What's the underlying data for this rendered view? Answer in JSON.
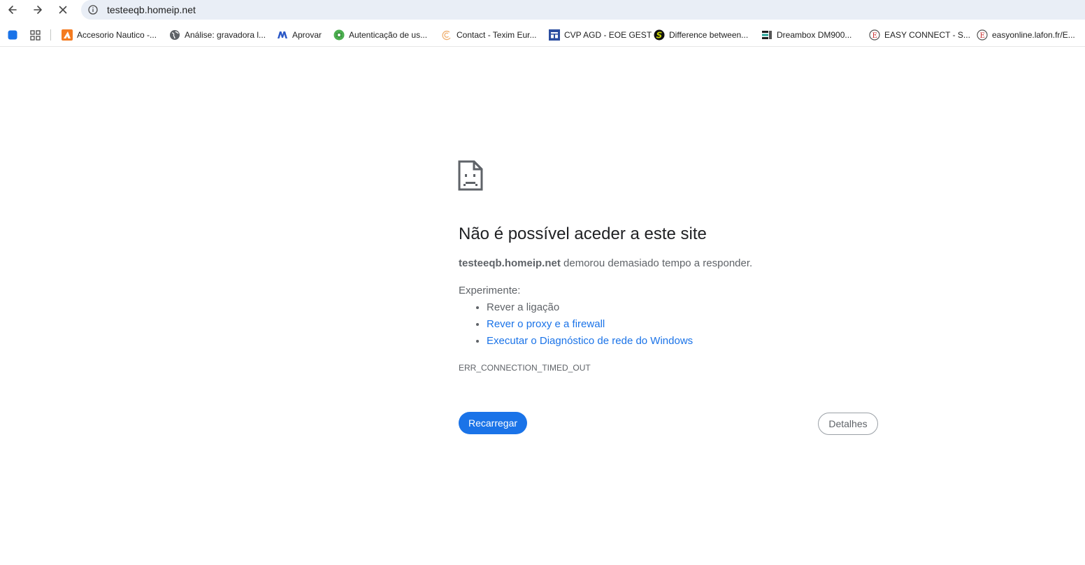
{
  "browser": {
    "url": "testeeqb.homeip.net",
    "nav": {
      "back_icon": "arrow-left-icon",
      "forward_icon": "arrow-right-icon",
      "stop_icon": "close-icon",
      "site_info_icon": "info-icon"
    }
  },
  "bookmarks": [
    {
      "label": "Accesorio Nautico -...",
      "icon": "orange-triangle-icon",
      "color": "#f47b20"
    },
    {
      "label": "Análise: gravadora l...",
      "icon": "globe-icon",
      "color": "#5f6368"
    },
    {
      "label": "Aprovar",
      "icon": "m-logo-icon",
      "color": "#2b58c6"
    },
    {
      "label": "Autenticação de us...",
      "icon": "green-gear-icon",
      "color": "#4caf50"
    },
    {
      "label": "Contact - Texim Eur...",
      "icon": "swirl-icon",
      "color": "#f0b070"
    },
    {
      "label": "CVP AGD - EOE GEST",
      "icon": "blue-window-icon",
      "color": "#2c4ea0"
    },
    {
      "label": "Difference between...",
      "icon": "s-logo-icon",
      "color": "#c8d400"
    },
    {
      "label": "Dreambox DM900...",
      "icon": "db-logo-icon",
      "color": "#1f1f1f"
    },
    {
      "label": "EASY CONNECT - S...",
      "icon": "e-circle-icon",
      "color": "#c62828"
    },
    {
      "label": "easyonline.lafon.fr/E...",
      "icon": "e-circle-icon",
      "color": "#c62828"
    }
  ],
  "error": {
    "title": "Não é possível aceder a este site",
    "host": "testeeqb.homeip.net",
    "message_rest": " demorou demasiado tempo a responder.",
    "try_label": "Experimente:",
    "suggestions": [
      "Rever a ligação",
      "Rever o proxy e a firewall",
      "Executar o Diagnóstico de rede do Windows"
    ],
    "code": "ERR_CONNECTION_TIMED_OUT",
    "reload_label": "Recarregar",
    "details_label": "Detalhes"
  },
  "colors": {
    "accent": "#1a73e8",
    "text_primary": "#202124",
    "text_secondary": "#5f6368",
    "omnibox_bg": "#e9eef6"
  }
}
